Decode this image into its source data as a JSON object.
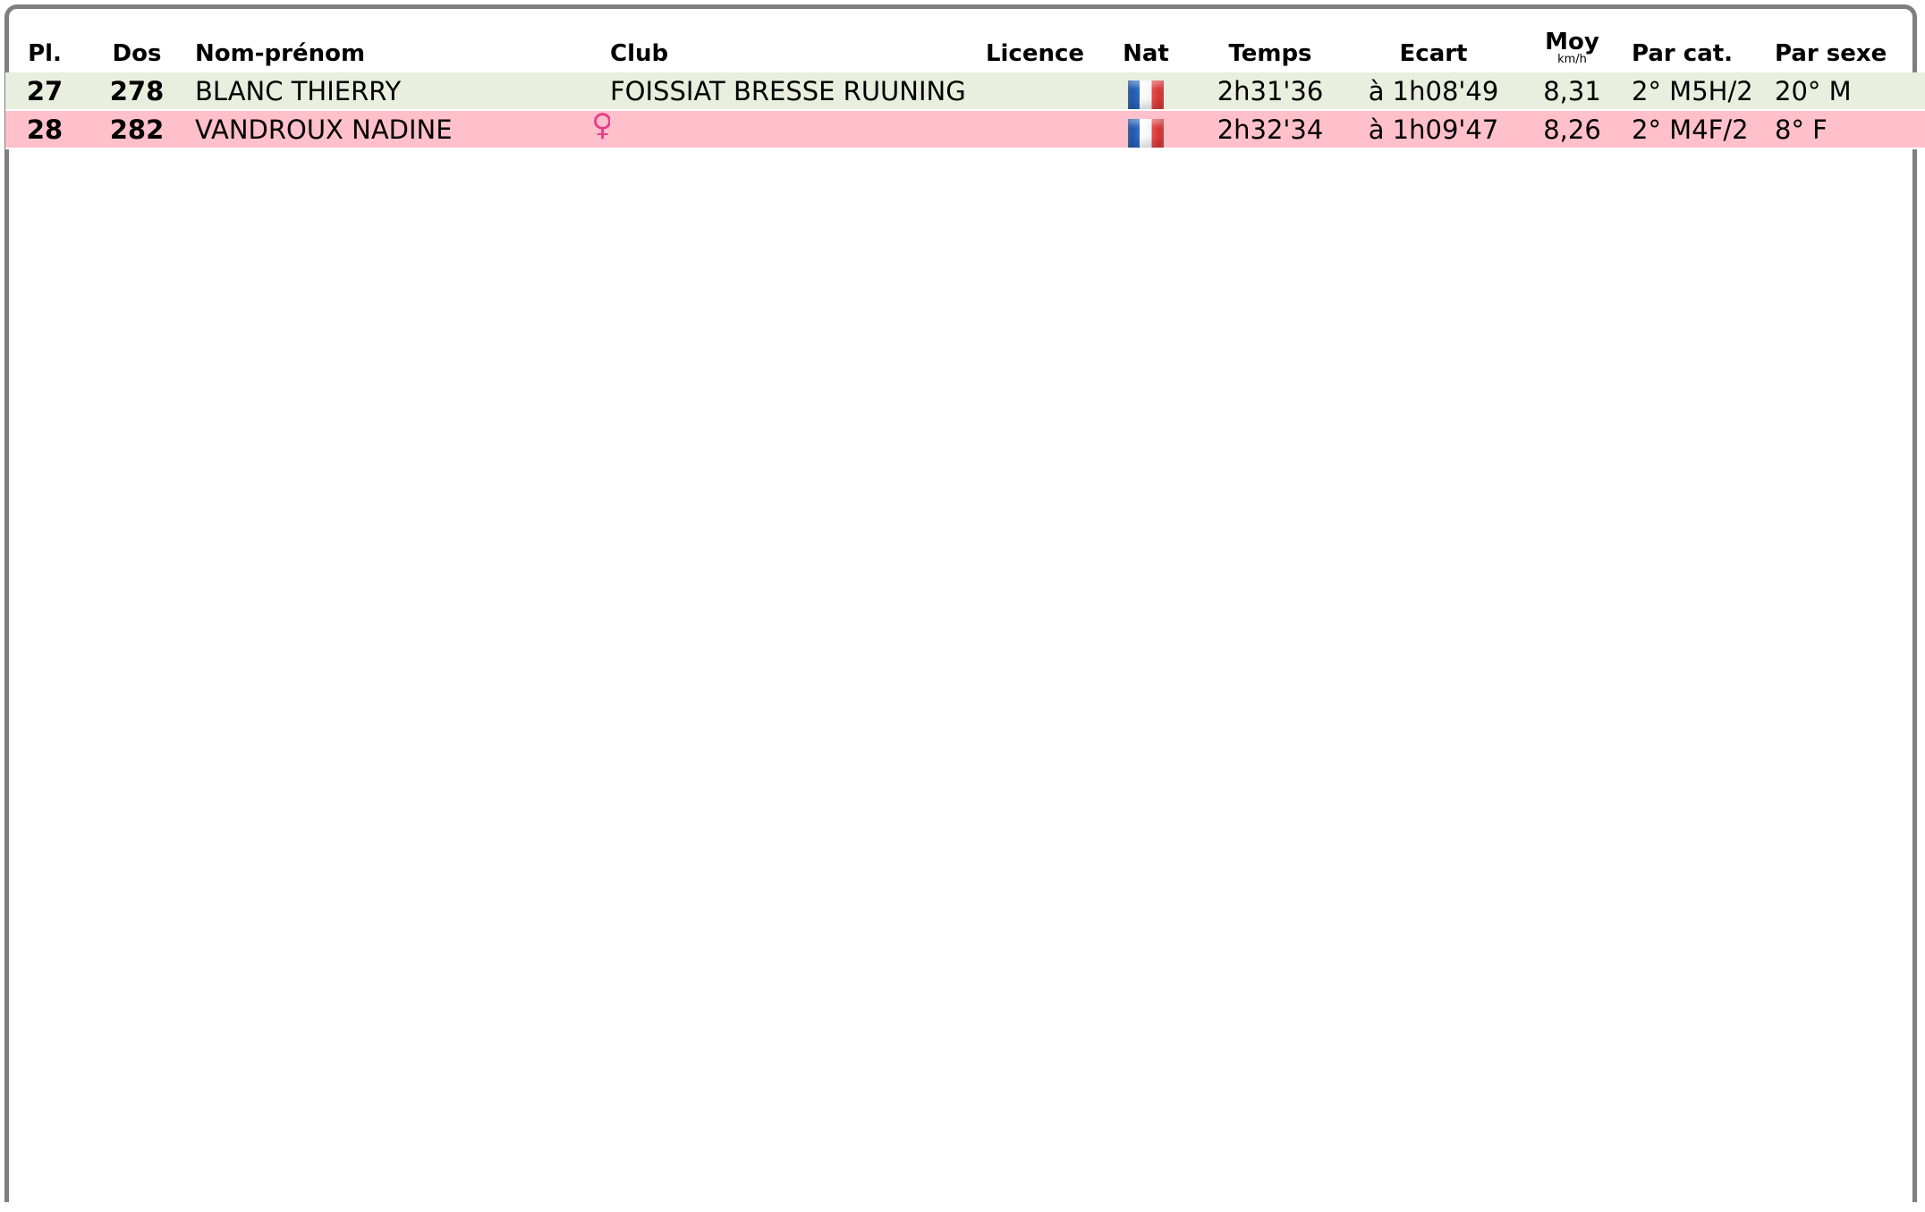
{
  "columns": {
    "pl": "Pl.",
    "dos": "Dos",
    "name": "Nom-prénom",
    "club": "Club",
    "licence": "Licence",
    "nat": "Nat",
    "temps": "Temps",
    "ecart": "Ecart",
    "moy": "Moy",
    "moy_unit": "km/h",
    "par_cat": "Par cat.",
    "par_sexe": "Par sexe"
  },
  "rows": [
    {
      "pl": "27",
      "dos": "278",
      "name": "BLANC THIERRY",
      "club": "FOISSIAT BRESSE RUUNING",
      "licence": "",
      "nat": "france-flag-icon",
      "temps": "2h31'36",
      "ecart": "à 1h08'49",
      "moy": "8,31",
      "par_cat": "2° M5H/2",
      "par_sexe": "20° M",
      "row_color": "#e8efdf"
    },
    {
      "pl": "28",
      "dos": "282",
      "name": "VANDROUX NADINE",
      "gender_icon": "♀",
      "club": "",
      "licence": "",
      "nat": "france-flag-icon",
      "temps": "2h32'34",
      "ecart": "à 1h09'47",
      "moy": "8,26",
      "par_cat": "2° M4F/2",
      "par_sexe": "8° F",
      "row_color": "#ffc0cb"
    }
  ],
  "colors": {
    "border": "#7f7f7f",
    "female_icon": "#e5408a"
  }
}
